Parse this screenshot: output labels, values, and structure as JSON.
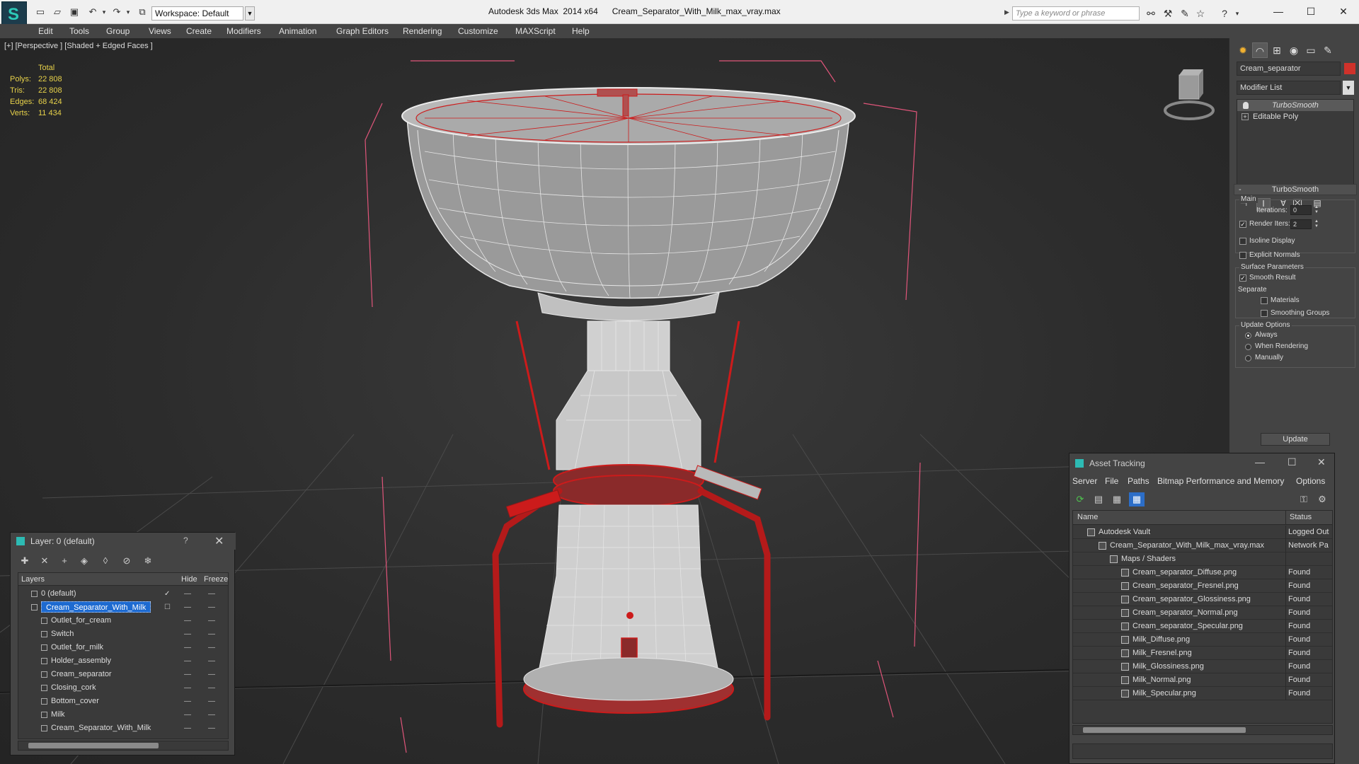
{
  "app": {
    "title": "Autodesk 3ds Max  2014 x64      Cream_Separator_With_Milk_max_vray.max",
    "workspace": "Workspace: Default",
    "search_placeholder": "Type a keyword or phrase"
  },
  "menu": [
    "Edit",
    "Tools",
    "Group",
    "Views",
    "Create",
    "Modifiers",
    "Animation",
    "Graph Editors",
    "Rendering",
    "Customize",
    "MAXScript",
    "Help"
  ],
  "viewport": {
    "label": "[+] [Perspective ] [Shaded + Edged Faces ]",
    "stats": {
      "header": "Total",
      "rows": [
        {
          "key": "Polys:",
          "value": "22 808"
        },
        {
          "key": "Tris:",
          "value": "22 808"
        },
        {
          "key": "Edges:",
          "value": "68 424"
        },
        {
          "key": "Verts:",
          "value": "11 434"
        }
      ]
    },
    "colors": {
      "wire": "#e8e8e8",
      "selection": "#cc1b1b",
      "bbox": "#e0557a"
    }
  },
  "command_panel": {
    "object_name": "Cream_separator",
    "object_color": "#d0322b",
    "modifier_list": "Modifier List",
    "stack": [
      "TurboSmooth",
      "Editable Poly"
    ],
    "rollout": {
      "title": "TurboSmooth",
      "main_label": "Main",
      "iterations_label": "Iterations:",
      "iterations": "0",
      "render_iters_label": "Render Iters:",
      "render_iters": "2",
      "render_iters_checked": true,
      "isoline_label": "Isoline Display",
      "explicit_label": "Explicit Normals",
      "surface_label": "Surface Parameters",
      "smooth_label": "Smooth Result",
      "smooth_checked": true,
      "separate_label": "Separate",
      "materials_label": "Materials",
      "smoothing_label": "Smoothing Groups",
      "update_options_label": "Update Options",
      "always_label": "Always",
      "when_rendering_label": "When Rendering",
      "manually_label": "Manually",
      "update_button": "Update"
    }
  },
  "layer_window": {
    "title": "Layer: 0 (default)",
    "help": "?",
    "columns": [
      "Layers",
      "Hide",
      "Freeze"
    ],
    "rows": [
      {
        "name": "0 (default)",
        "indent": 0,
        "type": "layer"
      },
      {
        "name": "Cream_Separator_With_Milk",
        "indent": 0,
        "type": "layer",
        "selected": true
      },
      {
        "name": "Outlet_for_cream",
        "indent": 1,
        "type": "object"
      },
      {
        "name": "Switch",
        "indent": 1,
        "type": "object"
      },
      {
        "name": "Outlet_for_milk",
        "indent": 1,
        "type": "object"
      },
      {
        "name": "Holder_assembly",
        "indent": 1,
        "type": "object"
      },
      {
        "name": "Cream_separator",
        "indent": 1,
        "type": "object"
      },
      {
        "name": "Closing_cork",
        "indent": 1,
        "type": "object"
      },
      {
        "name": "Bottom_cover",
        "indent": 1,
        "type": "object"
      },
      {
        "name": "Milk",
        "indent": 1,
        "type": "object"
      },
      {
        "name": "Cream_Separator_With_Milk",
        "indent": 1,
        "type": "object"
      }
    ]
  },
  "asset_tracking": {
    "title": "Asset Tracking",
    "menu": [
      "Server",
      "File",
      "Paths",
      "Bitmap Performance and Memory",
      "Options"
    ],
    "columns": [
      "Name",
      "Status"
    ],
    "rows": [
      {
        "name": "Autodesk Vault",
        "status": "Logged Out",
        "indent": 1
      },
      {
        "name": "Cream_Separator_With_Milk_max_vray.max",
        "status": "Network Pa",
        "indent": 2
      },
      {
        "name": "Maps / Shaders",
        "status": "",
        "indent": 3
      },
      {
        "name": "Cream_separator_Diffuse.png",
        "status": "Found",
        "indent": 4
      },
      {
        "name": "Cream_separator_Fresnel.png",
        "status": "Found",
        "indent": 4
      },
      {
        "name": "Cream_separator_Glossiness.png",
        "status": "Found",
        "indent": 4
      },
      {
        "name": "Cream_separator_Normal.png",
        "status": "Found",
        "indent": 4
      },
      {
        "name": "Cream_separator_Specular.png",
        "status": "Found",
        "indent": 4
      },
      {
        "name": "Milk_Diffuse.png",
        "status": "Found",
        "indent": 4
      },
      {
        "name": "Milk_Fresnel.png",
        "status": "Found",
        "indent": 4
      },
      {
        "name": "Milk_Glossiness.png",
        "status": "Found",
        "indent": 4
      },
      {
        "name": "Milk_Normal.png",
        "status": "Found",
        "indent": 4
      },
      {
        "name": "Milk_Specular.png",
        "status": "Found",
        "indent": 4
      }
    ]
  }
}
